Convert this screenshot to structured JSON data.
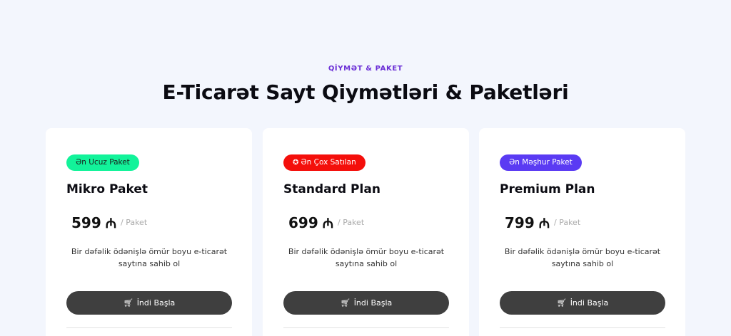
{
  "section": {
    "eyebrow": "QİYMƏT & PAKET",
    "title": "E-Ticarət Sayt Qiymətləri & Paketləri"
  },
  "plans": [
    {
      "badge": "Ən Ucuz Paket",
      "badge_color": "#12f39a",
      "name": "Mikro Paket",
      "price": "599",
      "currency": "₼",
      "per": "/ Paket",
      "description": "Bir dəfəlik ödənişlə ömür boyu e-ticarət saytına sahib ol",
      "cta": "İndi Başla"
    },
    {
      "badge": "Ən Çox Satılan",
      "badge_icon": "medal-icon",
      "badge_color": "#f40f0b",
      "name": "Standard Plan",
      "price": "699",
      "currency": "₼",
      "per": "/ Paket",
      "description": "Bir dəfəlik ödənişlə ömür boyu e-ticarət saytına sahib ol",
      "cta": "İndi Başla"
    },
    {
      "badge": "Ən Məşhur Paket",
      "badge_color": "#5a3bf3",
      "name": "Premium Plan",
      "price": "799",
      "currency": "₼",
      "per": "/ Paket",
      "description": "Bir dəfəlik ödənişlə ömür boyu e-ticarət saytına sahib ol",
      "cta": "İndi Başla"
    }
  ],
  "colors": {
    "background": "#f3f6fd",
    "eyebrow": "#6b2fd6",
    "button": "#3f3f3f"
  }
}
